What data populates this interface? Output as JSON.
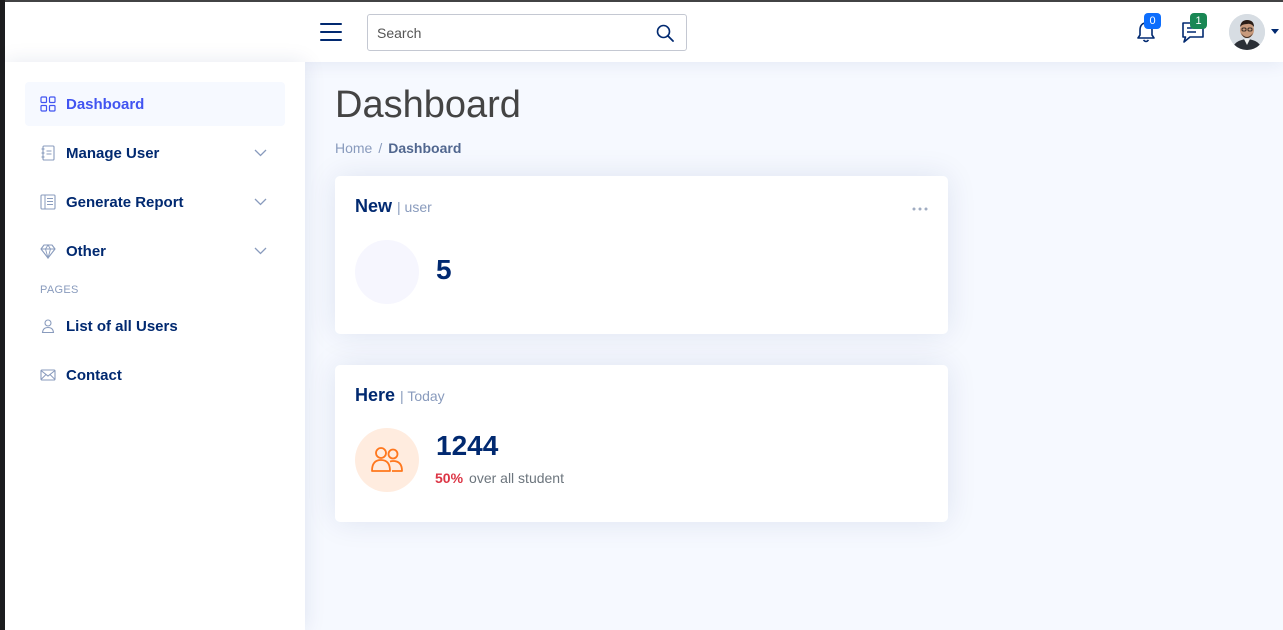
{
  "header": {
    "search_placeholder": "Search",
    "notifications_count": "0",
    "messages_count": "1"
  },
  "sidebar": {
    "items": [
      {
        "label": "Dashboard",
        "icon": "grid-icon",
        "active": true
      },
      {
        "label": "Manage User",
        "icon": "journal-text-icon"
      },
      {
        "label": "Generate Report",
        "icon": "layout-text-icon"
      },
      {
        "label": "Other",
        "icon": "gem-icon"
      }
    ],
    "pages_heading": "Pages",
    "pages": [
      {
        "label": "List of all Users",
        "icon": "person-icon"
      },
      {
        "label": "Contact",
        "icon": "envelope-icon"
      }
    ]
  },
  "main": {
    "title": "Dashboard",
    "breadcrumb": {
      "home": "Home",
      "separator": "/",
      "current": "Dashboard"
    },
    "cards": [
      {
        "title": "New",
        "subtitle": "| user",
        "value": "5"
      },
      {
        "title": "Here",
        "subtitle": "| Today",
        "value": "1244",
        "percent": "50%",
        "percent_text": "over all student"
      }
    ]
  },
  "colors": {
    "brand": "#012970",
    "accent": "#4154f1",
    "danger": "#dc3545",
    "customers_bg": "#ffecdf",
    "customers_icon": "#ff771d"
  }
}
